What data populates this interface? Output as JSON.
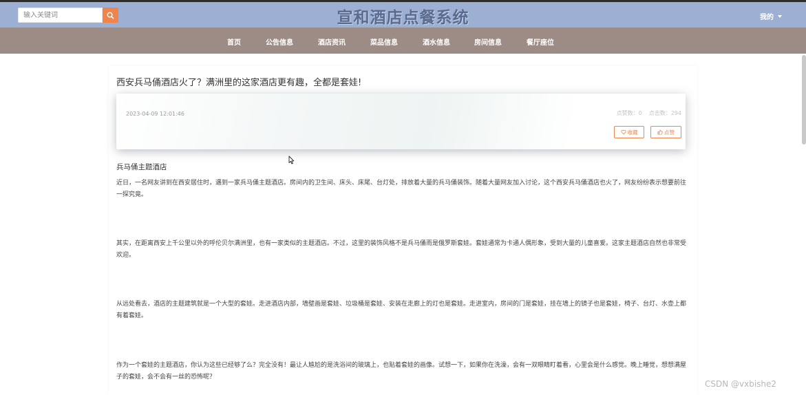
{
  "search": {
    "placeholder": "输入关键词",
    "button_icon": "search-icon"
  },
  "site_title": "宣和酒店点餐系统",
  "user_menu": {
    "label": "我的"
  },
  "nav": {
    "items": [
      {
        "label": "首页"
      },
      {
        "label": "公告信息"
      },
      {
        "label": "酒店资讯"
      },
      {
        "label": "菜品信息"
      },
      {
        "label": "酒水信息"
      },
      {
        "label": "房间信息"
      },
      {
        "label": "餐厅座位"
      }
    ]
  },
  "article": {
    "title": "西安兵马俑酒店火了？满洲里的这家酒店更有趣，全都是套娃!",
    "date": "2023-04-09 12:01:46",
    "likes_label": "点赞数：0",
    "clicks_label": "点击数：294",
    "favorite_label": "收藏",
    "like_label": "点赞",
    "section_heading": "兵马俑主题酒店",
    "paragraphs": [
      "近日，一名网友讲到在西安居住时，遇到一家兵马俑主题酒店。房间内的卫生间、床头、床尾、台灯处，排放着大量的兵马俑装饰。随着大量网友加入讨论，这个西安兵马俑酒店也火了，网友纷纷表示想要前往一探究竟。",
      "其实，在距离西安上千公里以外的呼伦贝尔满洲里，也有一家类似的主题酒店。不过，这里的装饰风格不是兵马俑而是俄罗斯套娃。套娃通常为卡通人偶形象，受到大量的儿童喜爱。这家主题酒店自然也非常受欢迎。",
      "从远处看去，酒店的主题建筑就是一个大型的套娃。走进酒店内部，墙壁画是套娃、垃圾桶是套娃、安装在走廊上的灯也是套娃。走进室内，房间的门是套娃，挂在墙上的镜子也是套娃，椅子、台灯、水壶上都有着套娃。",
      "作为一个套娃的主题酒店，你认为这些已经够了么？完全没有！最让人尴尬的是洗浴间的玻璃上，也贴着套娃的画像。试想一下，如果你在洗澡，会有一双眼睛盯着看，心里会是什么感觉。晚上睡觉，想想满屋子的套娃，会不会有一丝的恐怖呢？"
    ]
  },
  "watermark": "CSDN @vxbishe2",
  "colors": {
    "topbar": "#9bb0d3",
    "navbar": "#9d8c85",
    "accent": "#f0844a",
    "title": "#5a6b8f"
  }
}
